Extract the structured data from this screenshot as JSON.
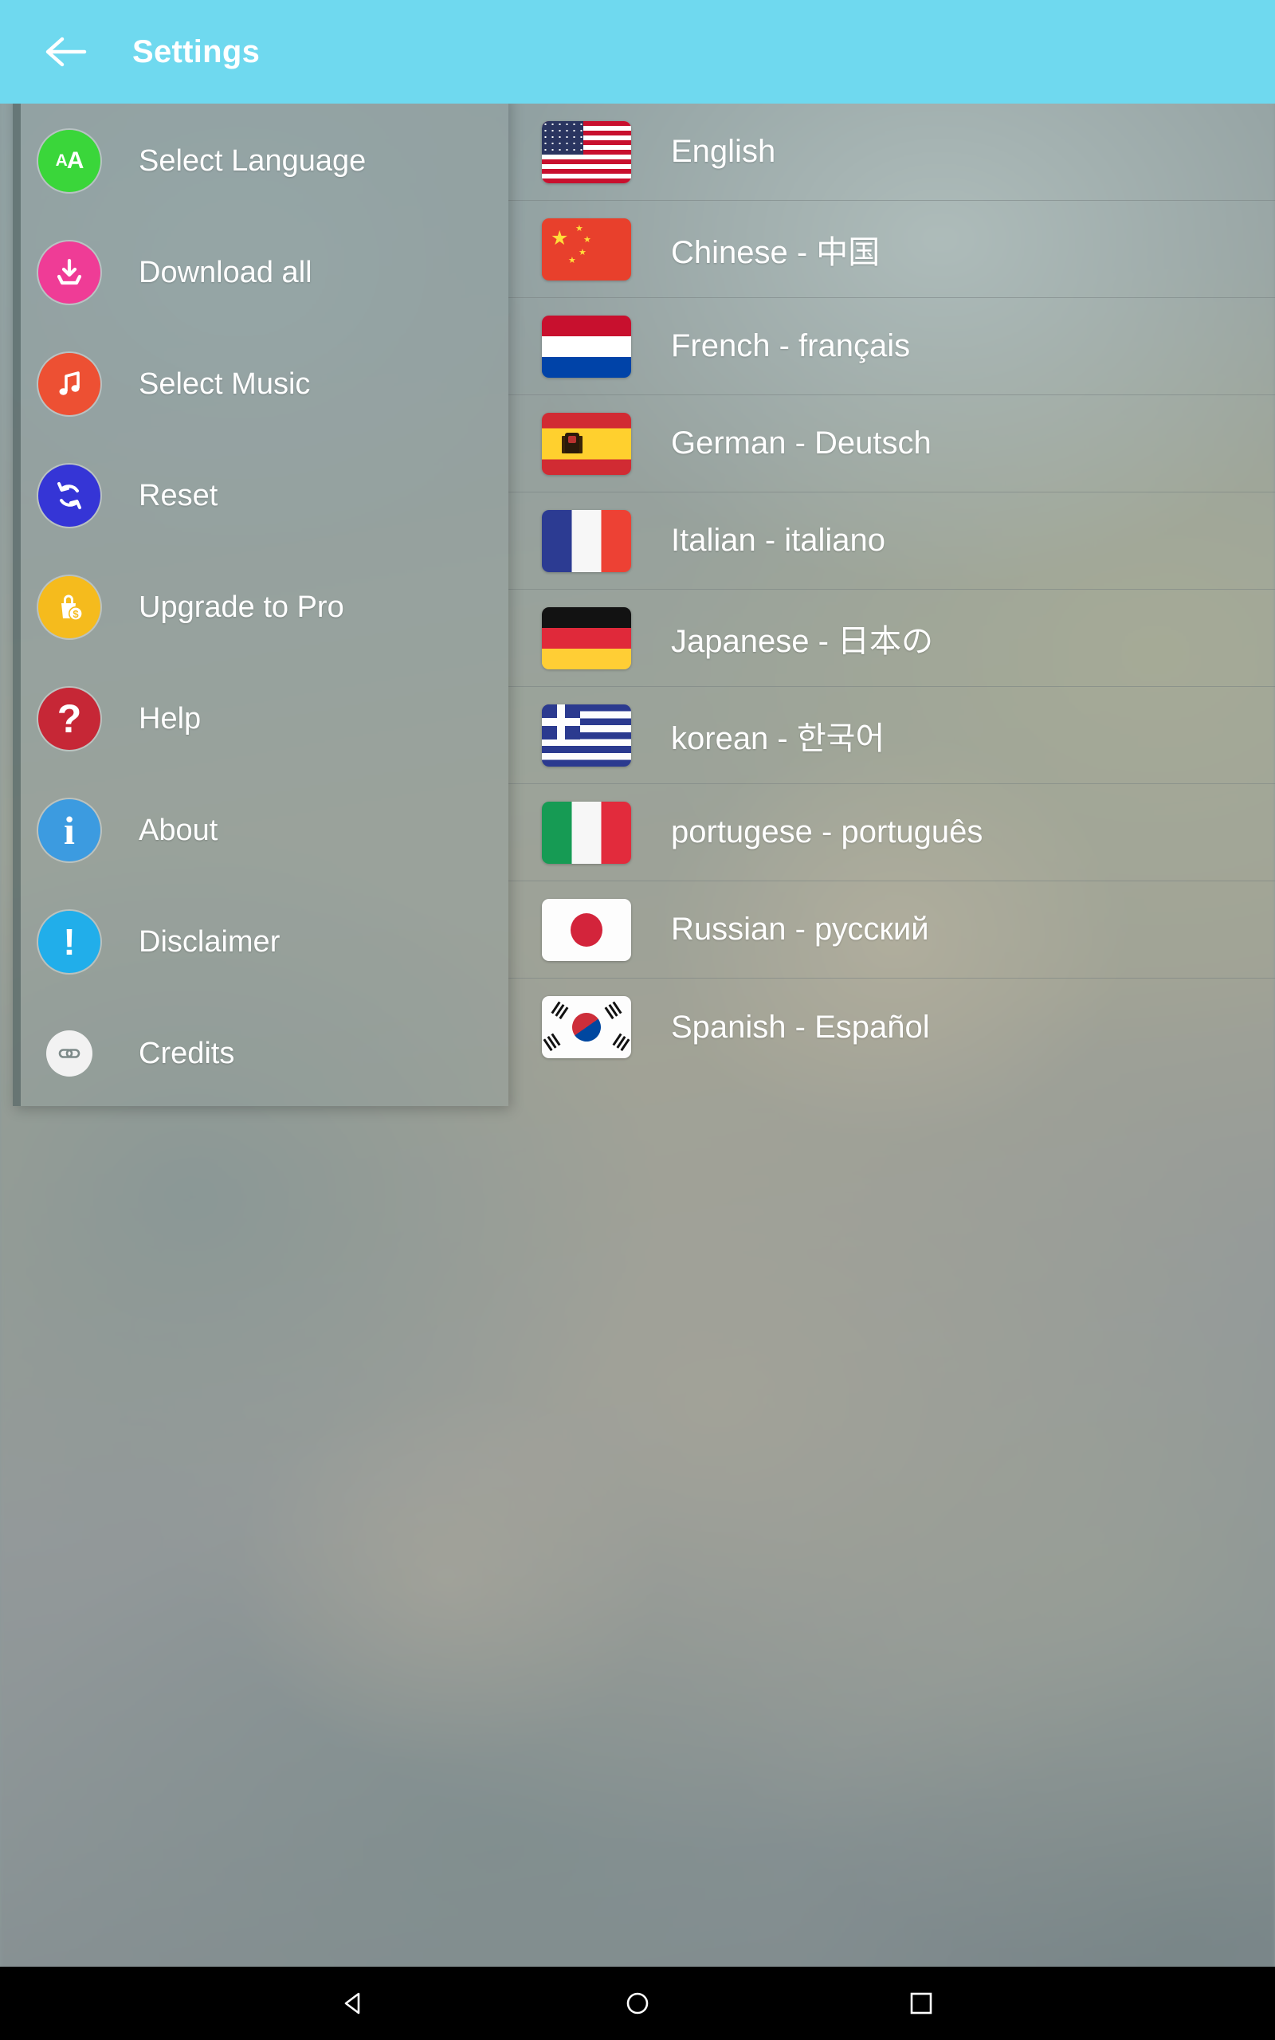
{
  "app": {
    "title": "Settings",
    "header_bg": "#6fd9ef",
    "back_icon": "back-arrow-icon"
  },
  "drawer": {
    "items": [
      {
        "label": "Select Language",
        "icon": "text-size-icon",
        "icon_color": "#3ad63a",
        "glyph": "aA"
      },
      {
        "label": "Download all",
        "icon": "download-icon",
        "icon_color": "#ef3c96",
        "glyph": "⤓"
      },
      {
        "label": "Select Music",
        "icon": "music-note-icon",
        "icon_color": "#ed5033",
        "glyph": "♫"
      },
      {
        "label": "Reset",
        "icon": "refresh-icon",
        "icon_color": "#3535d6",
        "glyph": "↻"
      },
      {
        "label": "Upgrade to Pro",
        "icon": "shopping-bag-dollar-icon",
        "icon_color": "#f5bb1d",
        "glyph": "$"
      },
      {
        "label": "Help",
        "icon": "question-mark-icon",
        "icon_color": "#c62736",
        "glyph": "?"
      },
      {
        "label": "About",
        "icon": "info-icon",
        "icon_color": "#3c9be0",
        "glyph": "i"
      },
      {
        "label": "Disclaimer",
        "icon": "warning-exclamation-icon",
        "icon_color": "#21aeea",
        "glyph": "!"
      },
      {
        "label": "Credits",
        "icon": "link-chain-icon",
        "icon_color": "#f2f2f2",
        "glyph": "⚭"
      }
    ]
  },
  "languages": {
    "items": [
      {
        "label": "English",
        "flag": "flag-usa-icon",
        "flag_class": "f-usa"
      },
      {
        "label": "Chinese - 中国",
        "flag": "flag-china-icon",
        "flag_class": "f-chn"
      },
      {
        "label": "French - français",
        "flag": "flag-netherlands-icon",
        "flag_class": "f-nld"
      },
      {
        "label": "German - Deutsch",
        "flag": "flag-spain-icon",
        "flag_class": "f-esp"
      },
      {
        "label": "Italian - italiano",
        "flag": "flag-france-icon",
        "flag_class": "f-fra"
      },
      {
        "label": "Japanese - 日本の",
        "flag": "flag-germany-icon",
        "flag_class": "f-deu"
      },
      {
        "label": "korean - 한국어",
        "flag": "flag-greece-icon",
        "flag_class": "f-grc"
      },
      {
        "label": "portugese - português",
        "flag": "flag-italy-icon",
        "flag_class": "f-ita"
      },
      {
        "label": "Russian - русский",
        "flag": "flag-japan-icon",
        "flag_class": "f-jpn"
      },
      {
        "label": "Spanish - Español",
        "flag": "flag-south-korea-icon",
        "flag_class": "f-kor"
      }
    ]
  },
  "navbar": {
    "back": "nav-back-icon",
    "home": "nav-home-icon",
    "recents": "nav-recents-icon"
  }
}
